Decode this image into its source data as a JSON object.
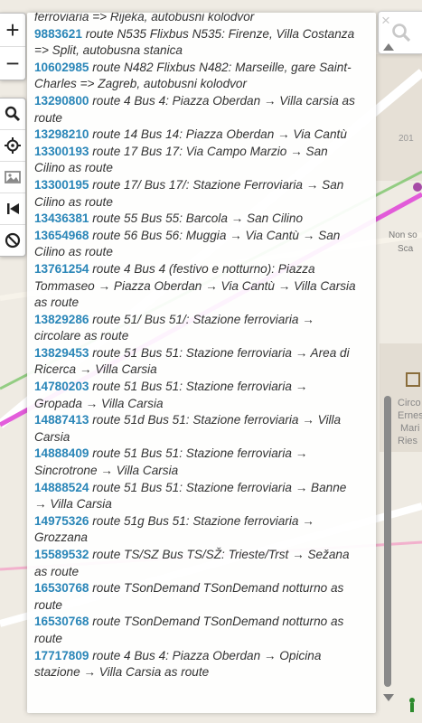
{
  "controls": {
    "zoom_in": "+",
    "zoom_out": "−"
  },
  "panel": {
    "close": "×",
    "items": [
      {
        "id": "",
        "text": "ferroviaria => Rijeka, autobusni kolodvor"
      },
      {
        "id": "9883621",
        "text": "route N535 Flixbus N535: Firenze, Villa Costanza => Split, autobusna stanica"
      },
      {
        "id": "10602985",
        "text": "route N482 Flixbus N482: Marseille, gare Saint-Charles => Zagreb, autobusni kolodvor"
      },
      {
        "id": "13290800",
        "text": "route 4 Bus 4: Piazza Oberdan → Villa carsia as route"
      },
      {
        "id": "13298210",
        "text": "route 14 Bus 14: Piazza Oberdan → Via Cantù"
      },
      {
        "id": "13300193",
        "text": "route 17 Bus 17: Via Campo Marzio → San Cilino as route"
      },
      {
        "id": "13300195",
        "text": "route 17/ Bus 17/: Stazione Ferroviaria → San Cilino as route"
      },
      {
        "id": "13436381",
        "text": "route 55 Bus 55: Barcola → San Cilino"
      },
      {
        "id": "13654968",
        "text": "route 56 Bus 56: Muggia → Via Cantù → San Cilino as route"
      },
      {
        "id": "13761254",
        "text": "route 4 Bus 4 (festivo e notturno): Piazza Tommaseo → Piazza Oberdan → Via Cantù → Villa Carsia as route"
      },
      {
        "id": "13829286",
        "text": "route 51/ Bus 51/: Stazione ferroviaria → circolare as route"
      },
      {
        "id": "13829453",
        "text": "route 51 Bus 51: Stazione ferroviaria → Area di Ricerca → Villa Carsia"
      },
      {
        "id": "14780203",
        "text": "route 51 Bus 51: Stazione ferroviaria → Gropada → Villa Carsia"
      },
      {
        "id": "14887413",
        "text": "route 51d Bus 51: Stazione ferroviaria → Villa Carsia"
      },
      {
        "id": "14888409",
        "text": "route 51 Bus 51: Stazione ferroviaria → Sincrotrone → Villa Carsia"
      },
      {
        "id": "14888524",
        "text": "route 51 Bus 51: Stazione ferroviaria → Banne → Villa Carsia"
      },
      {
        "id": "14975326",
        "text": "route 51g Bus 51: Stazione ferroviaria → Grozzana"
      },
      {
        "id": "15589532",
        "text": "route TS/SZ Bus TS/SŽ: Trieste/Trst → Sežana as route"
      },
      {
        "id": "16530768",
        "text": "route TSonDemand TSonDemand notturno as route"
      },
      {
        "id": "16530768",
        "text": "route TSonDemand TSonDemand notturno as route"
      },
      {
        "id": "17717809",
        "text": "route 4 Bus 4: Piazza Oberdan → Opicina stazione → Villa Carsia as route"
      }
    ]
  },
  "map_labels": {
    "label1": "Non so",
    "label2": "Sca",
    "label3": "Circo",
    "label4": "Ernes",
    "label5": "Mari",
    "label6": "Ries",
    "label7": "201"
  },
  "colors": {
    "link": "#2a86b8",
    "route_magenta": "#e04bd7",
    "route_green": "#7cc66a"
  }
}
